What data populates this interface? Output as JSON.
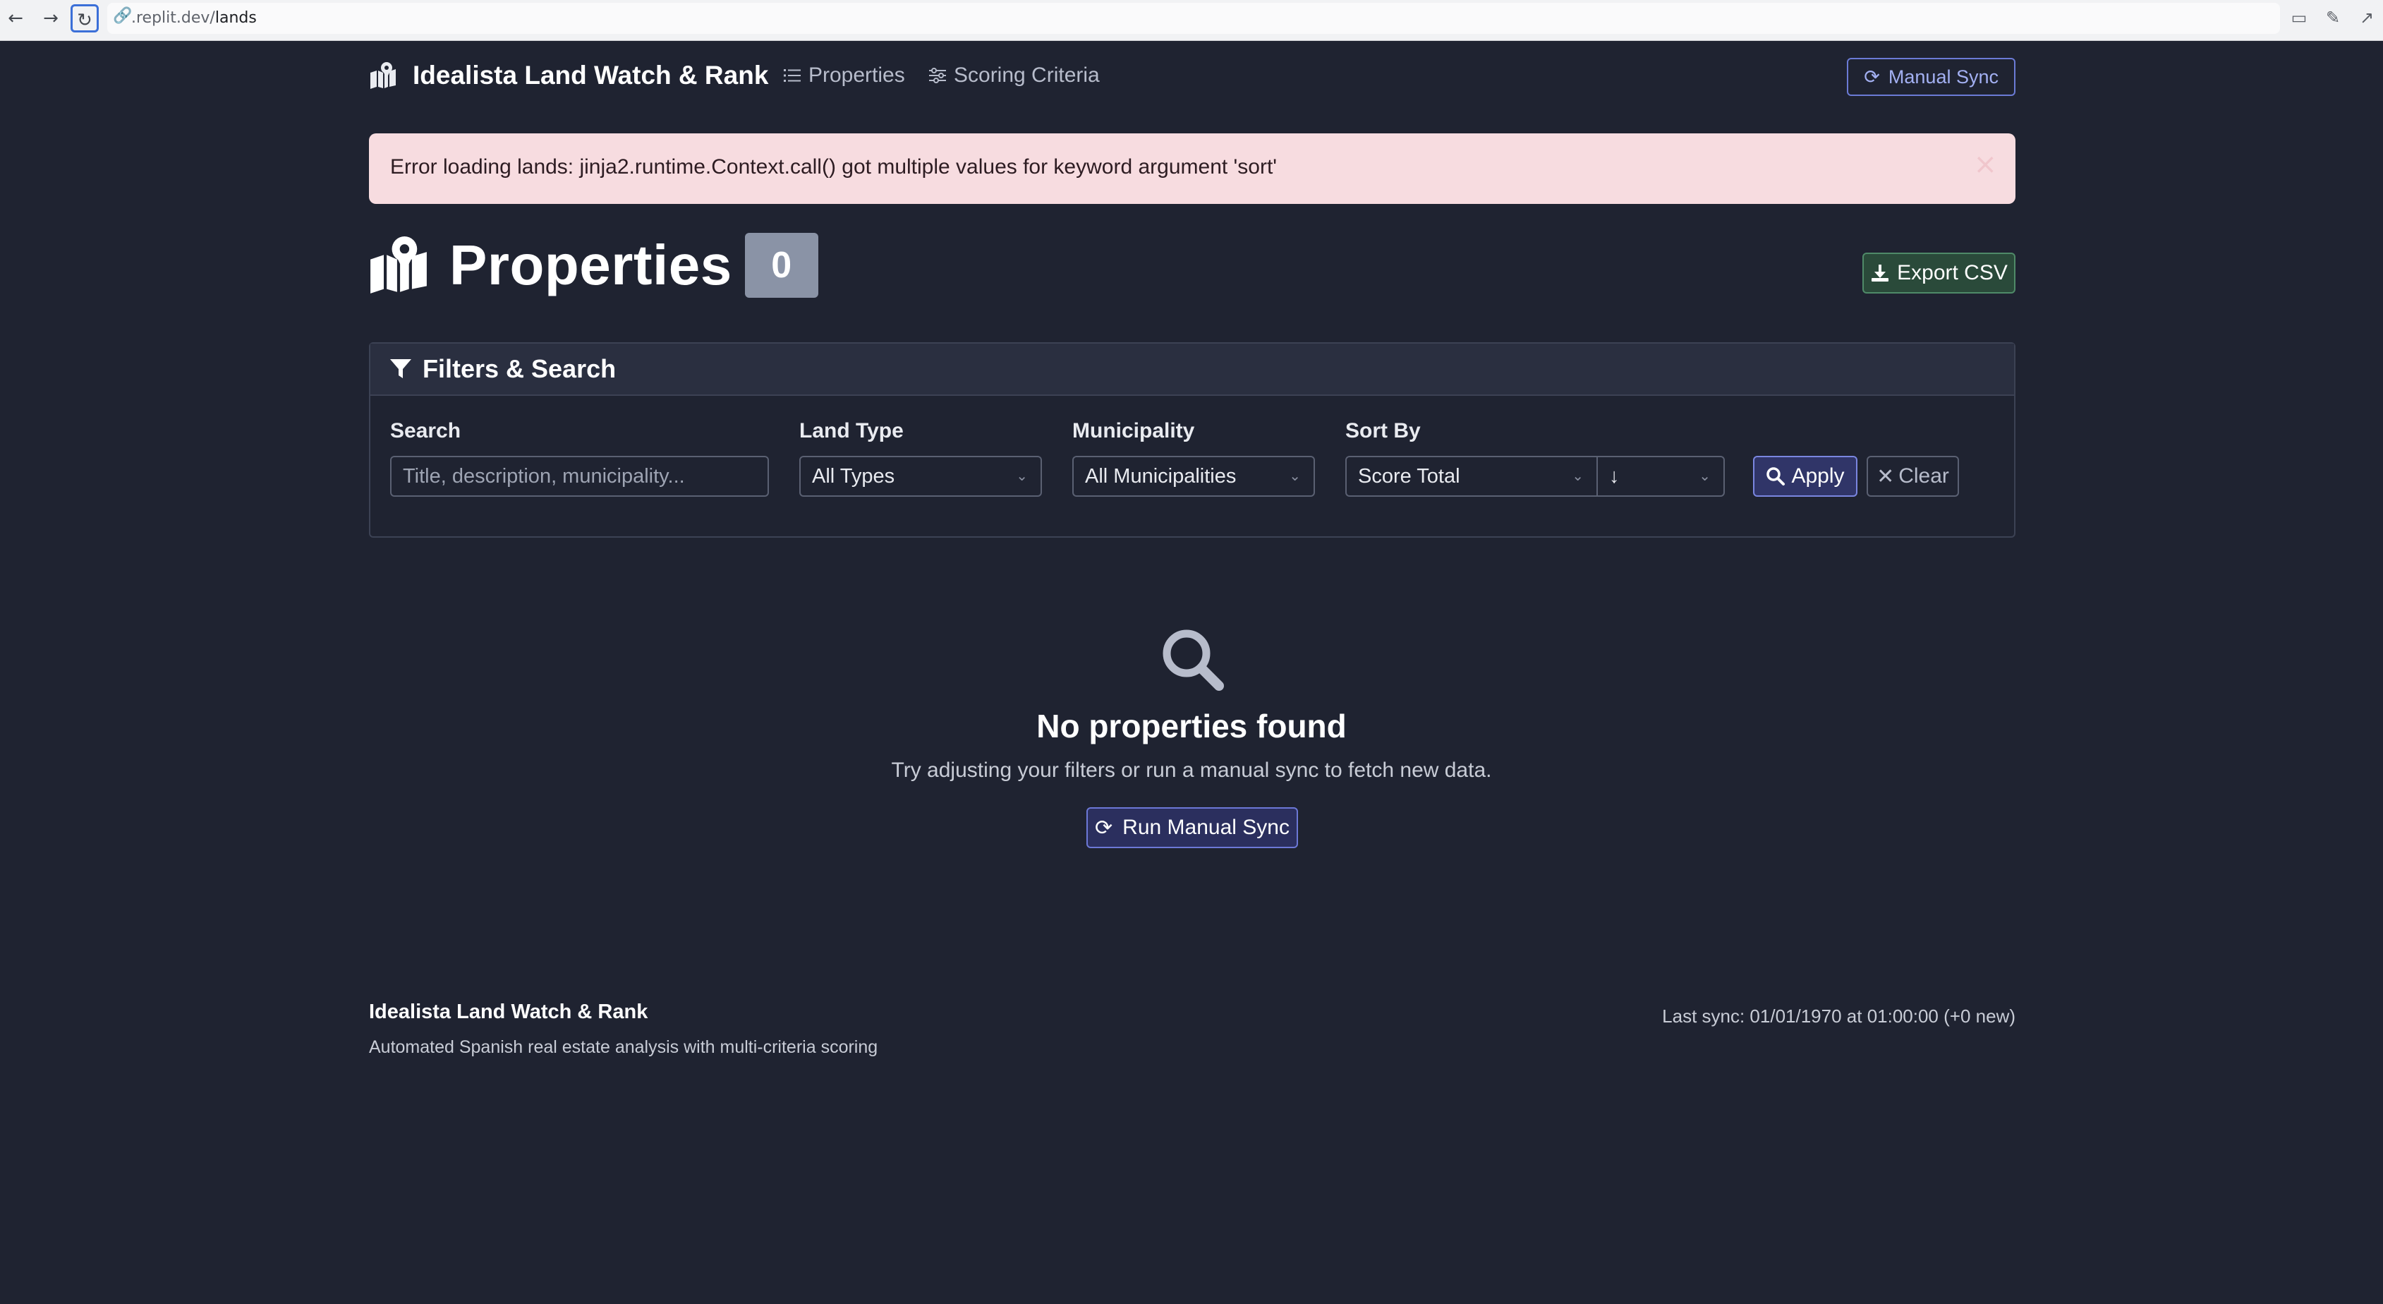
{
  "browser": {
    "url_prefix": ".replit.dev/",
    "url_path": "lands"
  },
  "nav": {
    "brand": "Idealista Land Watch & Rank",
    "links": [
      {
        "label": "Properties",
        "icon": "list-icon"
      },
      {
        "label": "Scoring Criteria",
        "icon": "sliders-icon"
      }
    ],
    "sync_button": "Manual Sync"
  },
  "alert": {
    "message": "Error loading lands: jinja2.runtime.Context.call() got multiple values for keyword argument 'sort'",
    "close": "×"
  },
  "page": {
    "title": "Properties",
    "count": "0",
    "export_button": "Export CSV"
  },
  "filters": {
    "header": "Filters & Search",
    "search": {
      "label": "Search",
      "placeholder": "Title, description, municipality..."
    },
    "land_type": {
      "label": "Land Type",
      "value": "All Types"
    },
    "municipality": {
      "label": "Municipality",
      "value": "All Municipalities"
    },
    "sort_by": {
      "label": "Sort By",
      "value": "Score Total",
      "direction": "↓"
    },
    "apply_button": "Apply",
    "clear_button": "Clear"
  },
  "empty": {
    "title": "No properties found",
    "subtitle": "Try adjusting your filters or run a manual sync to fetch new data.",
    "button": "Run Manual Sync"
  },
  "footer": {
    "title": "Idealista Land Watch & Rank",
    "subtitle": "Automated Spanish real estate analysis with multi-criteria scoring",
    "last_sync": "Last sync: 01/01/1970 at 01:00:00 (+0 new)"
  },
  "colors": {
    "background": "#1f2331",
    "accent": "#6b7bd6",
    "alert_bg": "#f7dce0",
    "export": "#2a4a3a"
  }
}
